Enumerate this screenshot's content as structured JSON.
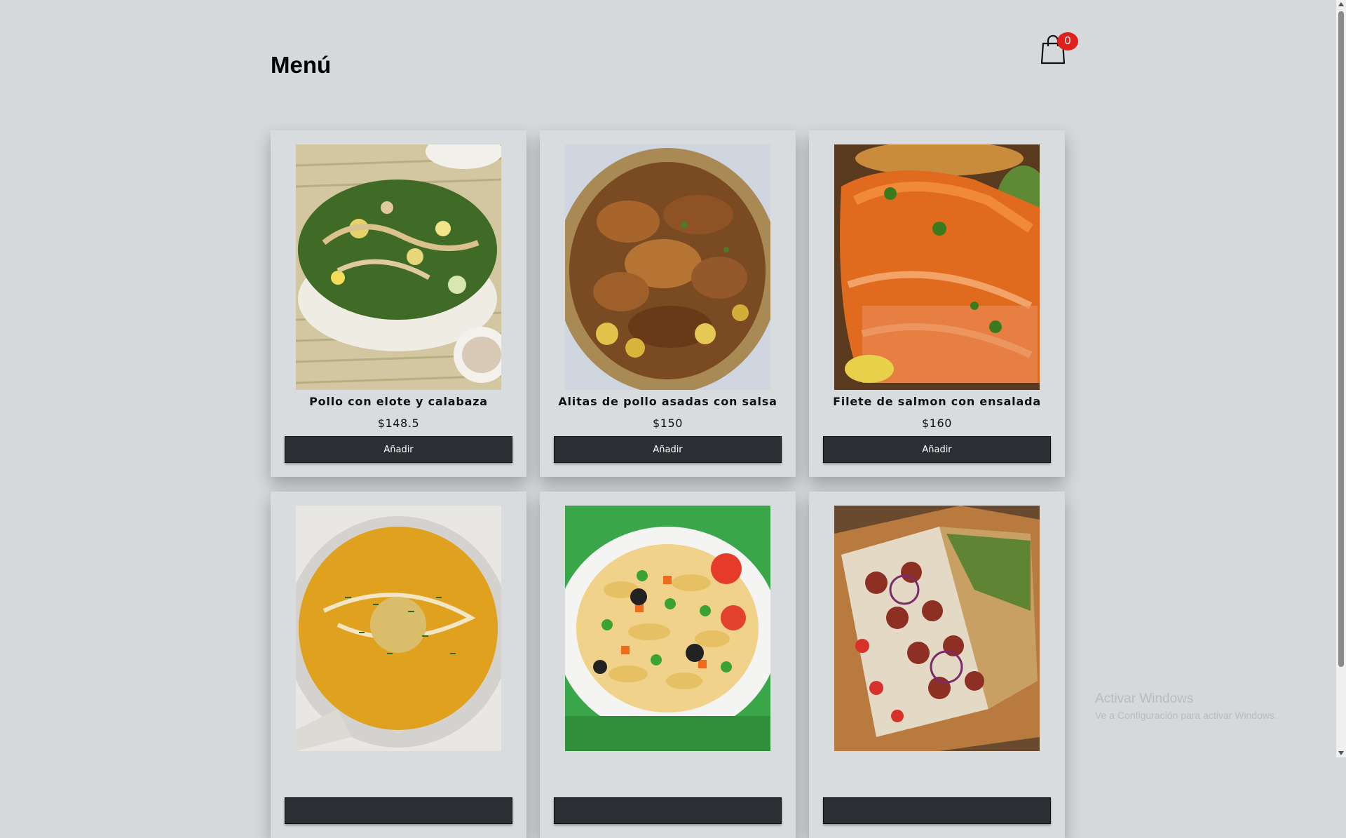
{
  "header": {
    "title": "Menú",
    "cart_count": "0"
  },
  "products": [
    {
      "name": "Pollo con elote y calabaza",
      "price": "$148.5",
      "button": "Añadir"
    },
    {
      "name": "Alitas de pollo asadas con salsa",
      "price": "$150",
      "button": "Añadir"
    },
    {
      "name": "Filete de salmon con ensalada",
      "price": "$160",
      "button": "Añadir"
    },
    {
      "name": "",
      "price": "",
      "button": ""
    },
    {
      "name": "",
      "price": "",
      "button": ""
    },
    {
      "name": "",
      "price": "",
      "button": ""
    }
  ],
  "watermark": {
    "title": "Activar Windows",
    "subtitle": "Ve a Configuración para activar Windows."
  },
  "icons": {
    "cart": "shopping-bag-icon"
  },
  "colors": {
    "badge": "#e0201b",
    "button": "#2b2f33",
    "background": "#d6d9dc"
  }
}
